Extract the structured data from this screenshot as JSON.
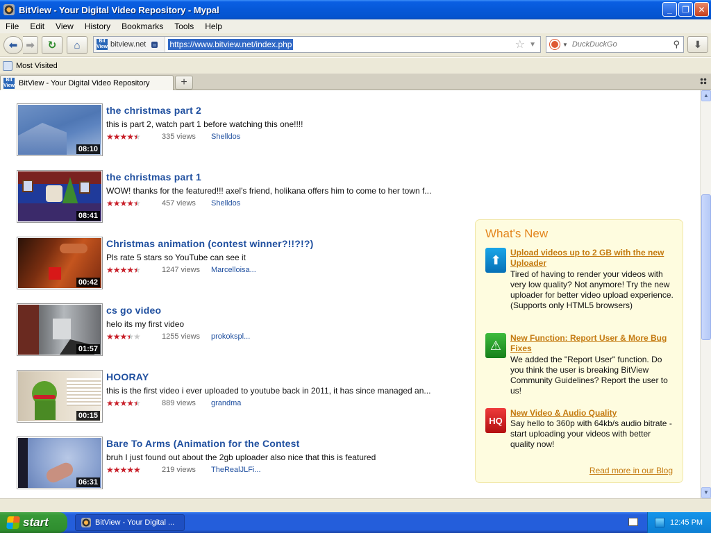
{
  "window": {
    "title": "BitView - Your Digital Video Repository - Mypal"
  },
  "menu": [
    {
      "label": "File"
    },
    {
      "label": "Edit"
    },
    {
      "label": "View"
    },
    {
      "label": "History"
    },
    {
      "label": "Bookmarks"
    },
    {
      "label": "Tools"
    },
    {
      "label": "Help"
    }
  ],
  "nav": {
    "site_logo": "Bit View",
    "site_domain": "bitview.net",
    "url": "https://www.bitview.net/index.php",
    "search_placeholder": "DuckDuckGo"
  },
  "bookmarks": {
    "most_visited": "Most Visited"
  },
  "tab": {
    "title": "BitView - Your Digital Video Repository"
  },
  "videos": [
    {
      "title": "the christmas part 2",
      "desc": "this is part 2, watch part 1 before watching this one!!!!",
      "rating": 4.5,
      "views": "335 views",
      "author": "Shelldos",
      "duration": "08:10"
    },
    {
      "title": "the christmas part 1",
      "desc": "WOW! thanks for the featured!!! axel's friend, holikana offers him to come to her town f...",
      "rating": 4.5,
      "views": "457 views",
      "author": "Shelldos",
      "duration": "08:41"
    },
    {
      "title": "Christmas animation (contest winner?!!?!?)",
      "desc": "Pls rate 5 stars so YouTube can see it",
      "rating": 4.5,
      "views": "1247 views",
      "author": "Marcelloisa...",
      "duration": "00:42"
    },
    {
      "title": "cs go video",
      "desc": "helo its my first video",
      "rating": 3.5,
      "views": "1255 views",
      "author": "prokokspl...",
      "duration": "01:57"
    },
    {
      "title": "HOORAY",
      "desc": "this is the first video i ever uploaded to youtube back in 2011, it has since managed an...",
      "rating": 4.5,
      "views": "889 views",
      "author": "grandma",
      "duration": "00:15"
    },
    {
      "title": "Bare To Arms (Animation for the Contest",
      "desc": "bruh I just found out about the 2gb uploader also nice that this is featured",
      "rating": 5,
      "views": "219 views",
      "author": "TheRealJLFi...",
      "duration": "06:31"
    }
  ],
  "whats_new": {
    "heading": "What's New",
    "items": [
      {
        "icon": "upload-icon",
        "link": "Upload videos up to 2 GB with the new Uploader",
        "text": "Tired of having to render your videos with very low quality? Not anymore! Try the new uploader for better video upload experience. (Supports only HTML5 browsers)"
      },
      {
        "icon": "warning-icon",
        "link": "New Function: Report User & More Bug Fixes",
        "text": "We added the \"Report User\" function. Do you think the user is breaking BitView Community Guidelines? Report the user to us!"
      },
      {
        "icon": "hq-icon",
        "link": "New Video & Audio Quality",
        "icon_text": "HQ",
        "text": "Say hello to 360p with 64kb/s audio bitrate - start uploading your videos with better quality now!"
      }
    ],
    "read_more": "Read more in our Blog"
  },
  "taskbar": {
    "start": "start",
    "item": "BitView - Your Digital ...",
    "clock": "12:45 PM"
  }
}
